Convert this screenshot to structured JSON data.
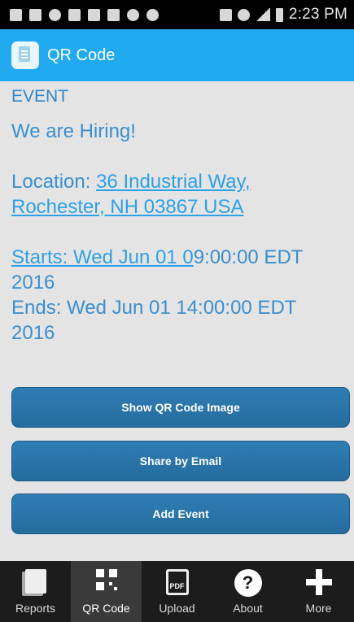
{
  "status_bar": {
    "time": "2:23 PM"
  },
  "action_bar": {
    "title": "QR Code",
    "icon": "app-document-icon"
  },
  "content": {
    "type_label": "EVENT",
    "title": "We are Hiring!",
    "location_label": "Location: ",
    "location_line1": "36 Industrial Way,",
    "location_line2": "Rochester, NH 03867 USA",
    "starts_link": "Starts: Wed Jun 01 0",
    "starts_rest": "9:00:00 EDT",
    "starts_year": "2016",
    "ends_line1": "Ends: Wed Jun 01 14:00:00 EDT",
    "ends_year": "2016"
  },
  "buttons": {
    "show_qr": "Show QR Code Image",
    "share_email": "Share by Email",
    "add_event": "Add Event"
  },
  "tabs": [
    {
      "label": "Reports",
      "icon": "reports-icon",
      "active": false
    },
    {
      "label": "QR Code",
      "icon": "qr-code-icon",
      "active": true
    },
    {
      "label": "Upload",
      "icon": "pdf-icon",
      "active": false
    },
    {
      "label": "About",
      "icon": "help-icon",
      "active": false
    },
    {
      "label": "More",
      "icon": "plus-icon",
      "active": false
    }
  ],
  "colors": {
    "action_bar": "#22aaf0",
    "button": "#2a72a6",
    "link": "#2ea0e6",
    "text": "#3a8fd0",
    "tab_bar": "#1c1c1c"
  }
}
